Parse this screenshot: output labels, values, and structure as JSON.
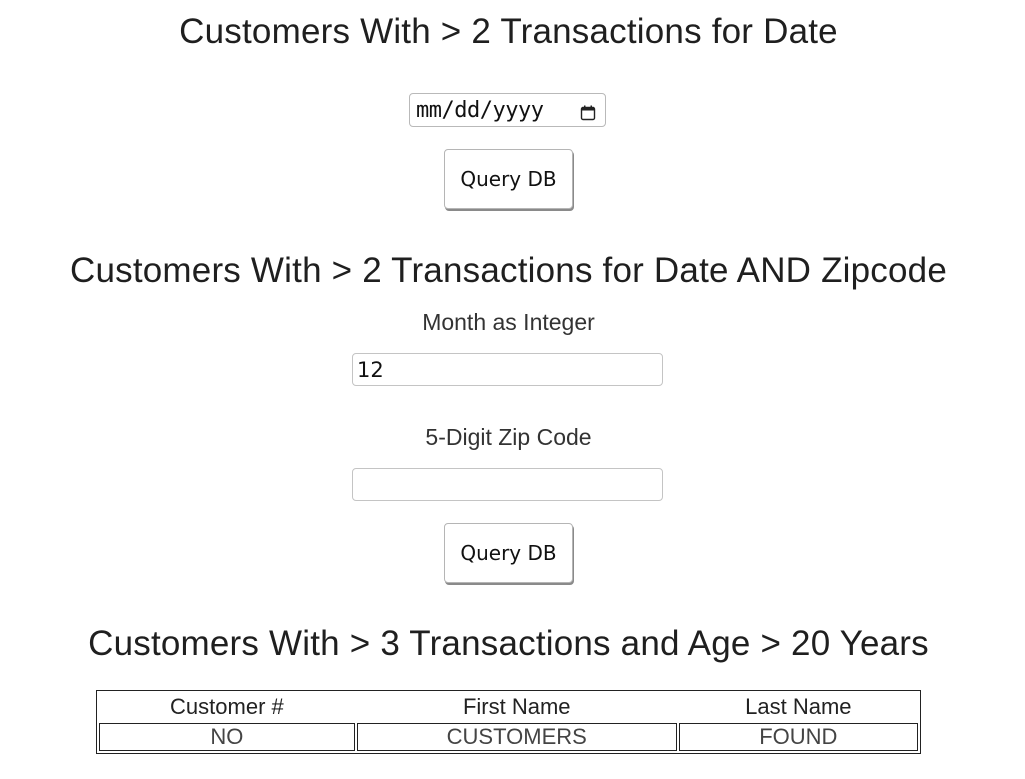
{
  "section1": {
    "heading": "Customers With > 2 Transactions for Date",
    "date_placeholder": "mm/dd/yyyy",
    "button_label": "Query DB"
  },
  "section2": {
    "heading": "Customers With > 2 Transactions for Date AND Zipcode",
    "month_label": "Month as Integer",
    "month_value": "12",
    "zip_label": "5-Digit Zip Code",
    "zip_value": "",
    "button_label": "Query DB"
  },
  "section3": {
    "heading": "Customers With > 3 Transactions and Age > 20 Years",
    "table": {
      "columns": [
        "Customer #",
        "First Name",
        "Last Name"
      ],
      "rows": [
        [
          "NO",
          "CUSTOMERS",
          "FOUND"
        ]
      ]
    }
  },
  "icons": {
    "date_picker": "calendar-icon"
  }
}
